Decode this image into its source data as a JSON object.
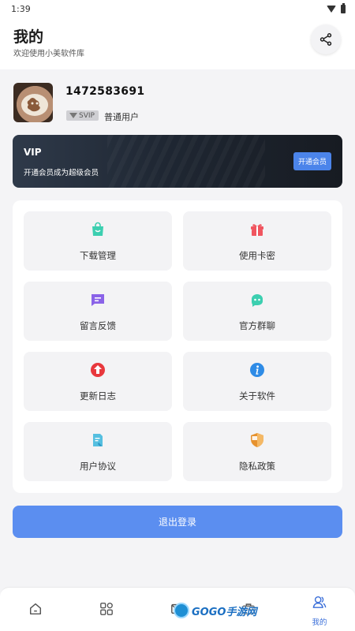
{
  "status_bar": {
    "time": "1:39"
  },
  "header": {
    "title": "我的",
    "subtitle": "欢迎使用小美软件库",
    "share_icon": "share-icon"
  },
  "profile": {
    "user_id": "1472583691",
    "badge": "SVIP",
    "user_type": "普通用户"
  },
  "vip": {
    "title": "VIP",
    "description": "开通会员成为超级会员",
    "button_label": "开通会员"
  },
  "menu": {
    "items": [
      {
        "label": "下载管理",
        "icon": "shopping-bag-icon",
        "color": "#3ccfb0"
      },
      {
        "label": "使用卡密",
        "icon": "gift-icon",
        "color": "#f0555f"
      },
      {
        "label": "留言反馈",
        "icon": "message-icon",
        "color": "#8a63e8"
      },
      {
        "label": "官方群聊",
        "icon": "chat-bot-icon",
        "color": "#3ccfb0"
      },
      {
        "label": "更新日志",
        "icon": "upload-arrow-icon",
        "color": "#e8383d"
      },
      {
        "label": "关于软件",
        "icon": "info-icon",
        "color": "#2e8be6"
      },
      {
        "label": "用户协议",
        "icon": "document-icon",
        "color": "#55bfe0"
      },
      {
        "label": "隐私政策",
        "icon": "shield-icon",
        "color": "#e6922e"
      }
    ]
  },
  "logout": {
    "label": "退出登录"
  },
  "bottom_nav": {
    "items": [
      {
        "icon": "home-icon"
      },
      {
        "icon": "apps-grid-icon"
      },
      {
        "icon": "mail-icon"
      },
      {
        "icon": "toolbox-icon"
      },
      {
        "icon": "user-icon",
        "label": "我的",
        "active": true
      }
    ]
  },
  "watermark": {
    "text": "GOGO手游网"
  },
  "colors": {
    "accent": "#5b8ef0",
    "nav_active": "#3b6fd9",
    "vip_button": "#4b84ea"
  }
}
